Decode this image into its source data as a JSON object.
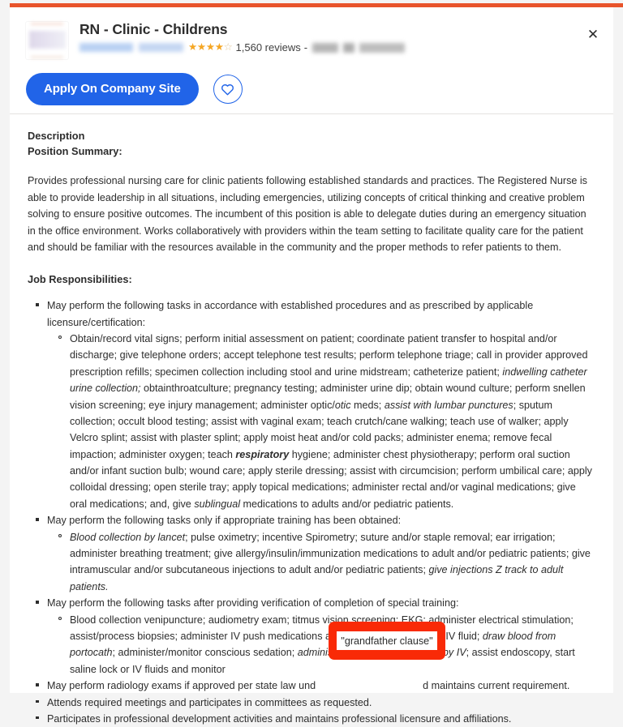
{
  "theme": {
    "accent_bar_color": "#e8542b",
    "primary_button_color": "#2164e8",
    "star_color": "#f5a623",
    "annotation_color": "#f92a07",
    "page_background": "#f4f4f4",
    "card_background": "#ffffff"
  },
  "header": {
    "job_title": "RN - Clinic - Childrens",
    "close_label": "✕",
    "rating": {
      "stars_filled": 4,
      "stars_total": 5,
      "filled_glyph": "★",
      "empty_glyph": "☆",
      "reviews_text": "1,560 reviews",
      "separator": "-"
    },
    "apply_button_label": "Apply On Company Site",
    "save_button_label": "save-job"
  },
  "body": {
    "description_label": "Description",
    "position_summary_label": "Position Summary:",
    "summary_paragraph": "Provides professional nursing care for clinic patients following established standards and practices. The Registered Nurse is able to provide leadership in all situations, including emergencies, utilizing concepts of critical thinking and creative problem solving to ensure positive outcomes. The incumbent of this position is able to delegate duties during an emergency situation in the office environment. Works collaboratively with providers within the team setting to facilitate quality care for the patient and should be familiar with the resources available in the community and the proper methods to refer patients to them.",
    "responsibilities_label": "Job Responsibilities:",
    "bullets": {
      "b1": "May perform the following tasks in accordance with established procedures and as prescribed by applicable licensure/certification:",
      "b1s1_p1": "Obtain/record vital signs; perform initial assessment on patient; coordinate patient transfer to hospital and/or discharge; give telephone orders; accept telephone test results; perform telephone triage; call in provider approved prescription refills; specimen collection including stool and urine midstream; catheterize patient; ",
      "b1s1_i1": "indwelling catheter urine collection;",
      "b1s1_p2": " obtainthroatculture; pregnancy testing; administer urine dip; obtain wound culture; perform snellen vision screening; eye injury management; administer optic/",
      "b1s1_i2": "otic",
      "b1s1_p3": " meds; ",
      "b1s1_i3": "assist with lumbar punctures",
      "b1s1_p4": "; sputum collection; occult blood testing; assist with vaginal exam; teach crutch/cane walking; teach use of walker; apply Velcro splint; assist with plaster splint; apply moist heat and/or cold packs; administer enema; remove fecal impaction; administer oxygen; teach ",
      "b1s1_i4": "respiratory",
      "b1s1_p5": " hygiene; administer chest physiotherapy; perform oral suction and/or infant suction bulb; wound care; apply sterile dressing; assist with circumcision; perform umbilical care; apply colloidal dressing; open sterile tray; apply topical medications; administer rectal and/or vaginal medications; give oral medications; and, give ",
      "b1s1_i5": "sublingual",
      "b1s1_p6": " medications to adults and/or pediatric patients.",
      "b2": "May perform the following tasks only if appropriate training has been obtained:",
      "b2s1_i1": "Blood collection by lancet",
      "b2s1_p1": "; pulse oximetry; incentive Spirometry; suture and/or staple removal; ear irrigation; administer breathing treatment; give allergy/insulin/immunization medications to adult and/or pediatric patients; give intramuscular and/or subcutaneous injections to adult and/or pediatric patients; ",
      "b2s1_i2": "give injections Z track to adult patients.",
      "b3": "May perform the following tasks after providing verification of completion of special training:",
      "b3s1_p1": "Blood collection venipuncture; audiometry exam; titmus vision screening; EKG; administer electrical stimulation; assist/process biopsies; administer IV push medications and/or add medications to IV fluid; ",
      "b3s1_i1": "draw blood from portocath",
      "b3s1_p2": "; administer/monitor conscious sedation; ",
      "b3s1_i2": "administer radio contrast media by IV",
      "b3s1_p3": "; assist endoscopy, start saline lock or IV fluids and monitor",
      "b4_p1": "May perform radiology exams if approved per state law und",
      "b4_p2": "d maintains current requirement.",
      "b5": "Attends required meetings and participates in committees as requested.",
      "b6": "Participates in professional development activities and maintains professional licensure and affiliations."
    }
  },
  "annotation": {
    "highlight_text": "\"grandfather clause\""
  }
}
